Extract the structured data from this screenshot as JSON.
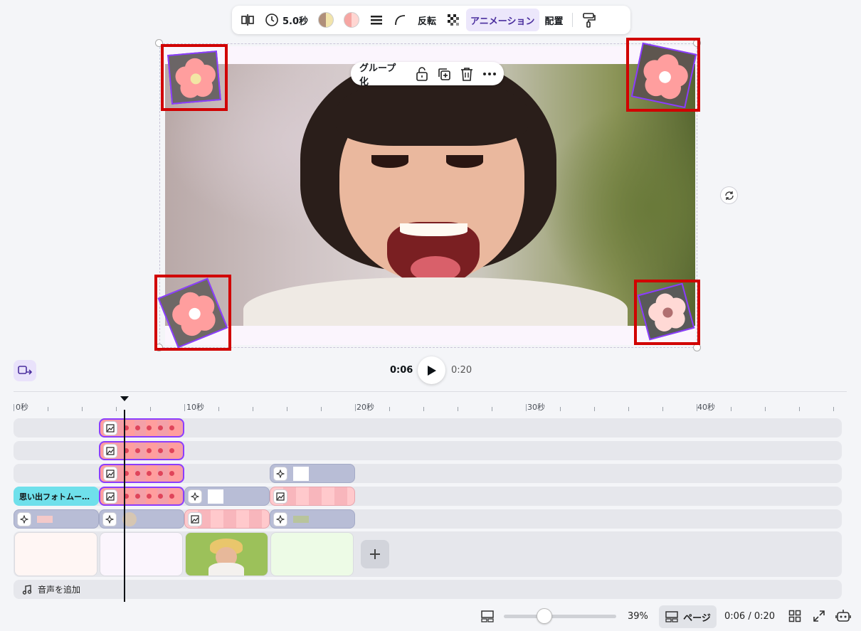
{
  "toolbar": {
    "duration_label": "5.0秒",
    "flip_label": "反転",
    "animation_label": "アニメーション",
    "position_label": "配置",
    "icons": [
      "split-icon",
      "clock-icon",
      "color-swatch-icon",
      "color-swatch-icon",
      "border-style-icon",
      "corner-rounding-icon",
      "transparency-icon",
      "paint-roller-icon"
    ],
    "swatch_colors": [
      "#e9cfa0",
      "#f6a6a3"
    ]
  },
  "group_menu": {
    "label": "グループ化",
    "icons": [
      "unlock-icon",
      "duplicate-icon",
      "trash-icon",
      "more-icon"
    ]
  },
  "canvas": {
    "background_color": "#fbf5fd",
    "flower_colors": [
      "#ff9e9e",
      "#ff9e9e",
      "#ff9e9e",
      "#ffd9d5"
    ],
    "flower_center_colors": [
      "#f2e6a4",
      "#ffffff",
      "#ffffff",
      "#b06f70"
    ],
    "highlight_color": "#d10000",
    "selection_color": "#8b3dff"
  },
  "playback": {
    "current_time": "0:06",
    "total_time": "0:20"
  },
  "ruler": {
    "labels": [
      "0秒",
      "10秒",
      "20秒",
      "30秒",
      "40秒"
    ]
  },
  "timeline": {
    "text_clip_label": "思い出フォトムー…",
    "audio_label": "音声を追加",
    "page_colors": [
      "#fff6f4",
      "#fbf5fd",
      "#9cc15a",
      "#edfbe6"
    ]
  },
  "bottom_bar": {
    "zoom": "39%",
    "zoom_fraction": 0.36,
    "page_view_label": "ページ",
    "time_readout": "0:06 / 0:20"
  }
}
